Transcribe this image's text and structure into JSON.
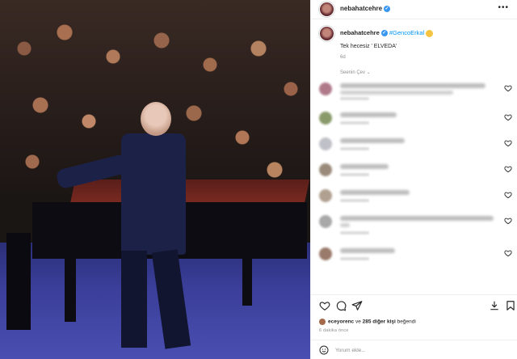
{
  "post": {
    "username": "nebahatcehre",
    "more_label": "•••",
    "caption": {
      "username": "nebahatcehre",
      "mention": "#GencoErkal",
      "text": "Tek hecesiz ' ELVEDA'",
      "time": "6d"
    },
    "translate_label": "Seenin Çev",
    "likes": {
      "first_user": "eceyorenc",
      "joiner": " ve ",
      "others": "285 diğer kişi",
      "suffix": " beğendi"
    },
    "time_ago": "6 dakika önce",
    "comment_placeholder": "Yorum ekle..."
  },
  "comments": [
    {
      "avatar_color": "#b07a8a"
    },
    {
      "avatar_color": "#8a9a6a"
    },
    {
      "avatar_color": "#c0c0c8"
    },
    {
      "avatar_color": "#9a8a7a"
    },
    {
      "avatar_color": "#b0a090"
    },
    {
      "avatar_color": "#a8a8a8"
    },
    {
      "avatar_color": "#9a7a6a"
    }
  ],
  "icons": [
    "heart-icon",
    "comment-icon",
    "share-icon",
    "save-icon",
    "emoji-icon",
    "verified-icon",
    "more-icon"
  ]
}
